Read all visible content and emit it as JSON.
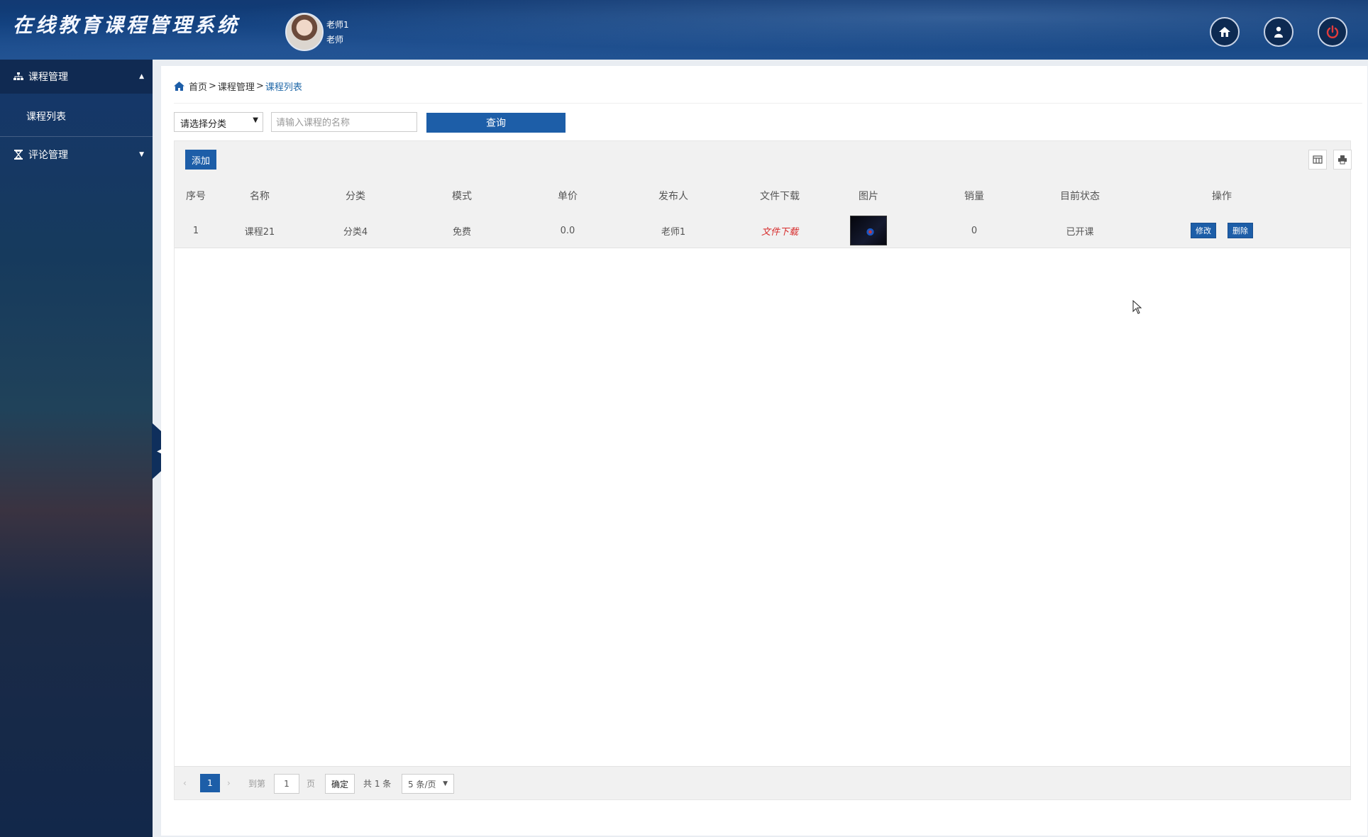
{
  "header": {
    "title": "在线教育课程管理系统",
    "user_name": "老师1",
    "user_role": "老师",
    "buttons": [
      "home-icon",
      "user-icon",
      "power-icon"
    ]
  },
  "sidebar": {
    "menus": [
      {
        "label": "课程管理",
        "icon": "sitemap-icon",
        "expanded": true,
        "items": [
          "课程列表"
        ]
      },
      {
        "label": "评论管理",
        "icon": "hourglass-icon",
        "expanded": false,
        "items": []
      }
    ]
  },
  "breadcrumb": {
    "home": "首页",
    "section": "课程管理",
    "current": "课程列表",
    "sep": ">"
  },
  "search": {
    "category_select": "请选择分类",
    "name_placeholder": "请输入课程的名称",
    "query_label": "查询"
  },
  "toolbar": {
    "add_label": "添加"
  },
  "table": {
    "headers": [
      "序号",
      "名称",
      "分类",
      "模式",
      "单价",
      "发布人",
      "文件下载",
      "图片",
      "销量",
      "目前状态",
      "操作"
    ],
    "rows": [
      {
        "index": "1",
        "name": "课程21",
        "category": "分类4",
        "mode": "免费",
        "price": "0.0",
        "publisher": "老师1",
        "download": "文件下载",
        "sales": "0",
        "status": "已开课",
        "edit": "修改",
        "delete": "删除"
      }
    ]
  },
  "pager": {
    "current": "1",
    "goto_label": "到第",
    "page_input": "1",
    "page_unit": "页",
    "confirm": "确定",
    "total": "共 1 条",
    "page_size": "5 条/页"
  },
  "colors": {
    "accent": "#1d5ea8",
    "download": "#d72b2b",
    "header": "#123a73"
  }
}
